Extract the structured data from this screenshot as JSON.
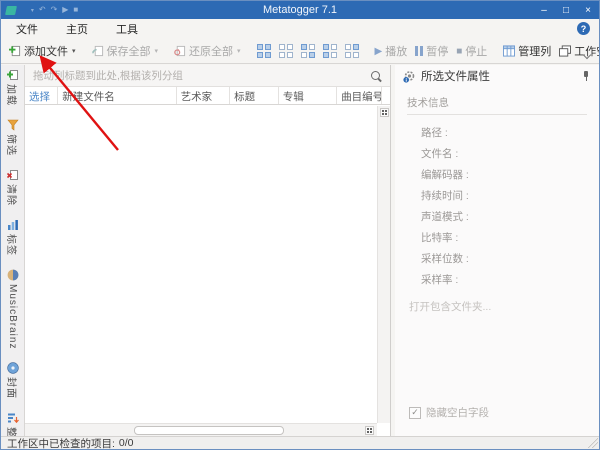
{
  "window": {
    "title": "Metatogger 7.1"
  },
  "titlebar": {
    "minimize_glyph": "–",
    "maximize_glyph": "□",
    "close_glyph": "×"
  },
  "qat": {
    "save_caret_glyph": "▾",
    "undo_glyph": "↶",
    "redo_glyph": "↷",
    "play_glyph": "▶",
    "stop_glyph": "■"
  },
  "tabs": [
    {
      "label": "文件"
    },
    {
      "label": "主页",
      "active": true
    },
    {
      "label": "工具"
    }
  ],
  "help": {
    "glyph": "?"
  },
  "toolbar": {
    "add_files_label": "添加文件",
    "save_all_label": "保存全部",
    "restore_all_label": "还原全部",
    "play_label": "播放",
    "pause_label": "暂停",
    "stop_label": "停止",
    "manage_columns_label": "管理列",
    "workspace_label": "工作空间",
    "more_label": "•••",
    "caret_glyph": "▾",
    "play_glyph": "▶",
    "stop_glyph": "■"
  },
  "sidebar": {
    "items": [
      {
        "label": "加载",
        "icon": "add-file-icon"
      },
      {
        "label": "筛选",
        "icon": "filter-icon"
      },
      {
        "label": "清除",
        "icon": "clean-icon"
      },
      {
        "label": "标签",
        "icon": "tag-icon"
      },
      {
        "label": "MusicBrainz",
        "icon": "musicbrainz-icon"
      },
      {
        "label": "封面",
        "icon": "cover-icon"
      },
      {
        "label": "整理",
        "icon": "organize-icon"
      }
    ]
  },
  "grid": {
    "group_hint": "拖动列标题到此处,根据该列分组",
    "columns": [
      {
        "label": "选择"
      },
      {
        "label": "新建文件名"
      },
      {
        "label": "艺术家"
      },
      {
        "label": "标题"
      },
      {
        "label": "专辑"
      },
      {
        "label": "曲目编号"
      }
    ]
  },
  "props": {
    "title": "所选文件属性",
    "section": "技术信息",
    "fields": [
      {
        "label": "路径 :"
      },
      {
        "label": "文件名 :"
      },
      {
        "label": "编解码器 :"
      },
      {
        "label": "持续时间 :"
      },
      {
        "label": "声道模式 :"
      },
      {
        "label": "比特率 :"
      },
      {
        "label": "采样位数 :"
      },
      {
        "label": "采样率 :"
      }
    ],
    "open_folder_label": "打开包含文件夹...",
    "hide_empty_label": "隐藏空白字段",
    "check_glyph": "✓"
  },
  "status": {
    "label": "工作区中已检查的项目:",
    "value": "0/0"
  },
  "colors": {
    "titlebar_blue": "#2d6ab4",
    "tab_underline": "#2b579a",
    "column_link_blue": "#4a86c7",
    "grid_icon_blue": "#b9cfe8",
    "annotation_arrow_red": "#e01212"
  }
}
